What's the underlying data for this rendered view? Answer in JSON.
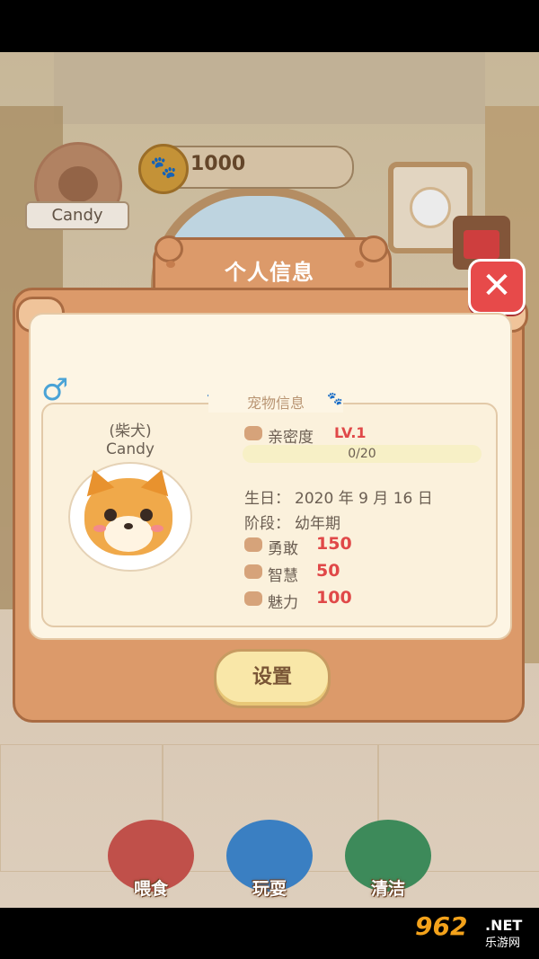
{
  "hud": {
    "player_name": "Candy",
    "coins": "1000"
  },
  "dialog": {
    "title": "个人信息",
    "close_icon": "crossed-bones-icon",
    "section_title": "宠物信息",
    "gender_symbol": "♂",
    "pet": {
      "breed": "(柴犬)",
      "name": "Candy"
    },
    "intimacy": {
      "label": "亲密度",
      "level": "LV.1",
      "progress_text": "0/20",
      "progress_fraction": 0.0
    },
    "birthday": {
      "label": "生日：",
      "value": "2020 年 9 月 16 日"
    },
    "stage": {
      "label": "阶段：",
      "value": "幼年期"
    },
    "stats": [
      {
        "label": "勇敢",
        "value": "150",
        "icon": "fist-icon"
      },
      {
        "label": "智慧",
        "value": "50",
        "icon": "graduation-cap-icon"
      },
      {
        "label": "魅力",
        "value": "100",
        "icon": "star-icon"
      }
    ],
    "settings_button": "设置"
  },
  "actions": [
    {
      "label": "喂食",
      "icon": "food-bowl-icon",
      "color": "#c0504a"
    },
    {
      "label": "玩耍",
      "icon": "frisbee-icon",
      "color": "#3a7fc2"
    },
    {
      "label": "清洁",
      "icon": "brush-icon",
      "color": "#3d8a5a"
    }
  ],
  "watermark": {
    "brand": "962",
    "domain": ".NET",
    "site": "乐游网"
  }
}
